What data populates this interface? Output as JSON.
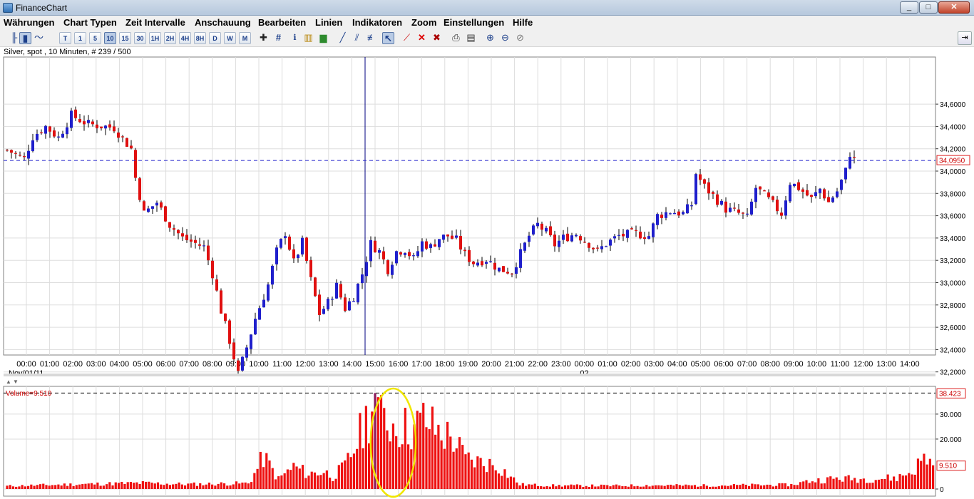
{
  "window": {
    "title": "FinanceChart",
    "controls": [
      "_",
      "□",
      "✕"
    ]
  },
  "menu": [
    "Währungen",
    "Chart Typen",
    "Zeit Intervalle",
    "Anschauung",
    "Bearbeiten",
    "Linien",
    "Indikatoren",
    "Zoom",
    "Einstellungen",
    "Hilfe"
  ],
  "toolbar": {
    "intervals": [
      "T",
      "1",
      "5",
      "10",
      "15",
      "30",
      "1H",
      "2H",
      "4H",
      "8H",
      "D",
      "W",
      "M"
    ],
    "selected_interval": "10",
    "icons": [
      "bar-chart-icon",
      "candlestick-icon",
      "line-chart-icon",
      "crosshair-icon",
      "grid-icon",
      "info-icon",
      "volume-bars-icon",
      "draw-line-icon",
      "draw-channel-icon",
      "draw-fibonacci-icon",
      "select-icon",
      "delete-line-icon",
      "delete-icon",
      "delete-all-icon",
      "print-icon",
      "print-preview-icon",
      "zoom-in-icon",
      "zoom-out-icon",
      "zoom-reset-icon",
      "pin-icon"
    ]
  },
  "chart_caption": "Silver, spot , 10 Minuten, # 239 / 500",
  "colors": {
    "up": "#1f1fcc",
    "down": "#e01010",
    "volume": "#ee1111",
    "highlight": "#f0e600",
    "grid": "#dddddd",
    "crosshair": "#000080"
  },
  "chart_data": [
    {
      "type": "candlestick",
      "instrument": "Silver, spot",
      "interval": "10 Minuten",
      "ylim": [
        34.05,
        34.68
      ],
      "yaxis_ticks": [
        "34,6000",
        "34,4000",
        "34,2000",
        "34,0000",
        "33,8000",
        "33,6000",
        "33,4000",
        "33,2000",
        "33,0000",
        "32,8000",
        "32,6000",
        "32,4000",
        "32,2000"
      ],
      "current_price_label": "34,0950",
      "current_price": 34.095,
      "xaxis_ticks": [
        "00:00",
        "01:00",
        "02:00",
        "03:00",
        "04:00",
        "05:00",
        "06:00",
        "07:00",
        "08:00",
        "09:00",
        "10:00",
        "11:00",
        "12:00",
        "13:00",
        "14:00",
        "15:00",
        "16:00",
        "17:00",
        "18:00",
        "19:00",
        "20:00",
        "21:00",
        "22:00",
        "23:00",
        "00:00",
        "01:00",
        "02:00",
        "03:00",
        "04:00",
        "05:00",
        "06:00",
        "07:00",
        "08:00",
        "09:00",
        "10:00",
        "11:00",
        "12:00",
        "13:00",
        "14:00"
      ],
      "date_labels": [
        {
          "text": "Nov/01/11",
          "tick_index": 0
        },
        {
          "text": "02",
          "tick_index": 24
        }
      ],
      "close_path": [
        [
          0,
          34.19
        ],
        [
          4,
          34.11
        ],
        [
          6,
          34.31
        ],
        [
          9,
          34.4
        ],
        [
          12,
          34.3
        ],
        [
          15,
          34.5
        ],
        [
          19,
          34.42
        ],
        [
          25,
          34.39
        ],
        [
          29,
          34.2
        ],
        [
          30,
          33.94
        ],
        [
          32,
          33.62
        ],
        [
          35,
          33.72
        ],
        [
          38,
          33.52
        ],
        [
          41,
          33.4
        ],
        [
          46,
          33.32
        ],
        [
          48,
          33.08
        ],
        [
          50,
          32.75
        ],
        [
          52,
          32.48
        ],
        [
          54,
          32.18
        ],
        [
          56,
          32.42
        ],
        [
          58,
          32.68
        ],
        [
          61,
          32.98
        ],
        [
          63,
          33.28
        ],
        [
          65,
          33.45
        ],
        [
          67,
          33.18
        ],
        [
          69,
          33.36
        ],
        [
          71,
          33.02
        ],
        [
          73,
          32.72
        ],
        [
          75,
          32.82
        ],
        [
          77,
          32.97
        ],
        [
          79,
          32.77
        ],
        [
          81,
          32.88
        ],
        [
          83,
          33.08
        ],
        [
          85,
          33.35
        ],
        [
          87,
          33.28
        ],
        [
          89,
          33.12
        ],
        [
          91,
          33.28
        ],
        [
          93,
          33.3
        ],
        [
          95,
          33.21
        ],
        [
          97,
          33.36
        ],
        [
          99,
          33.32
        ],
        [
          101,
          33.4
        ],
        [
          103,
          33.42
        ],
        [
          105,
          33.38
        ],
        [
          107,
          33.25
        ],
        [
          109,
          33.18
        ],
        [
          112,
          33.21
        ],
        [
          115,
          33.12
        ],
        [
          118,
          33.1
        ],
        [
          120,
          33.26
        ],
        [
          122,
          33.42
        ],
        [
          124,
          33.52
        ],
        [
          126,
          33.45
        ],
        [
          128,
          33.34
        ],
        [
          130,
          33.4
        ],
        [
          133,
          33.44
        ],
        [
          136,
          33.35
        ],
        [
          138,
          33.28
        ],
        [
          140,
          33.35
        ],
        [
          143,
          33.42
        ],
        [
          147,
          33.44
        ],
        [
          150,
          33.42
        ],
        [
          152,
          33.6
        ],
        [
          155,
          33.64
        ],
        [
          158,
          33.62
        ],
        [
          160,
          33.7
        ],
        [
          161,
          33.98
        ],
        [
          163,
          33.86
        ],
        [
          165,
          33.78
        ],
        [
          168,
          33.66
        ],
        [
          171,
          33.62
        ],
        [
          173,
          33.58
        ],
        [
          175,
          33.85
        ],
        [
          177,
          33.78
        ],
        [
          179,
          33.7
        ],
        [
          181,
          33.62
        ],
        [
          183,
          33.9
        ],
        [
          185,
          33.85
        ],
        [
          188,
          33.75
        ],
        [
          190,
          33.84
        ],
        [
          192,
          33.72
        ],
        [
          194,
          33.82
        ],
        [
          196,
          34.0
        ],
        [
          197,
          34.16
        ],
        [
          198,
          34.1
        ]
      ]
    },
    {
      "type": "bar",
      "title": "Volume",
      "current_value_label": "Volume=9.510",
      "current_value": 9510,
      "max_label": "38.423",
      "max_value": 38423,
      "ylim": [
        0,
        40000
      ],
      "yaxis_ticks": [
        "30.000",
        "20.000",
        "0"
      ],
      "highlighted_range": [
        121,
        135
      ],
      "volume_profile": [
        [
          0,
          1200
        ],
        [
          20,
          1800
        ],
        [
          45,
          2400
        ],
        [
          60,
          1900
        ],
        [
          80,
          2300
        ],
        [
          82,
          6000
        ],
        [
          85,
          13000
        ],
        [
          90,
          4000
        ],
        [
          95,
          9000
        ],
        [
          100,
          6000
        ],
        [
          105,
          7000
        ],
        [
          108,
          5000
        ],
        [
          112,
          9000
        ],
        [
          115,
          16000
        ],
        [
          118,
          25000
        ],
        [
          120,
          30000
        ],
        [
          122,
          38423
        ],
        [
          124,
          28000
        ],
        [
          126,
          27000
        ],
        [
          130,
          25000
        ],
        [
          135,
          24000
        ],
        [
          138,
          28000
        ],
        [
          143,
          23000
        ],
        [
          148,
          20000
        ],
        [
          152,
          12000
        ],
        [
          156,
          11000
        ],
        [
          160,
          10000
        ],
        [
          163,
          9000
        ],
        [
          170,
          1800
        ],
        [
          180,
          1400
        ],
        [
          200,
          1300
        ],
        [
          215,
          1500
        ],
        [
          230,
          1400
        ],
        [
          260,
          1700
        ],
        [
          266,
          3200
        ],
        [
          275,
          4200
        ],
        [
          285,
          4000
        ],
        [
          295,
          4500
        ],
        [
          300,
          7000
        ],
        [
          303,
          11000
        ],
        [
          305,
          13000
        ],
        [
          307,
          9510
        ]
      ]
    }
  ]
}
